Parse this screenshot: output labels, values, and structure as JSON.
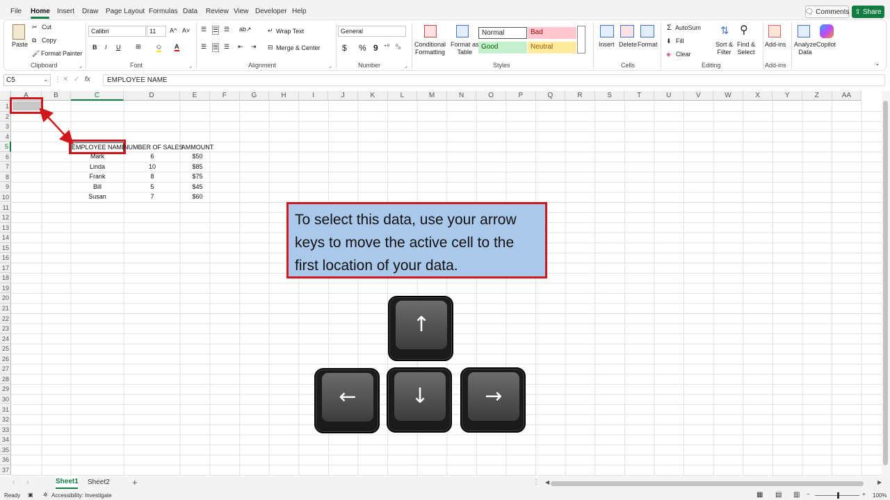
{
  "menu": {
    "tabs": [
      "File",
      "Home",
      "Insert",
      "Draw",
      "Page Layout",
      "Formulas",
      "Data",
      "Review",
      "View",
      "Developer",
      "Help"
    ],
    "comments": "Comments",
    "share": "Share"
  },
  "ribbon": {
    "clipboard": {
      "paste": "Paste",
      "cut": "Cut",
      "copy": "Copy",
      "format_painter": "Format Painter",
      "label": "Clipboard"
    },
    "font": {
      "family": "Calibri",
      "size": "11",
      "bold": "B",
      "italic": "I",
      "underline": "U",
      "label": "Font",
      "grow": "A^",
      "shrink": "A˅",
      "font_color_letter": "A"
    },
    "alignment": {
      "wrap_text": "Wrap Text",
      "merge_center": "Merge & Center",
      "label": "Alignment"
    },
    "number": {
      "format": "General",
      "currency": "$",
      "percent": "%",
      "comma": "9",
      "label": "Number"
    },
    "styles": {
      "conditional_formatting_1": "Conditional",
      "conditional_formatting_2": "Formatting",
      "format_as_table_1": "Format as",
      "format_as_table_2": "Table",
      "normal": "Normal",
      "bad": "Bad",
      "good": "Good",
      "neutral": "Neutral",
      "label": "Styles"
    },
    "cells": {
      "insert": "Insert",
      "delete": "Delete",
      "format": "Format",
      "label": "Cells"
    },
    "editing": {
      "autosum": "AutoSum",
      "fill": "Fill",
      "clear": "Clear",
      "sort_filter_1": "Sort &",
      "sort_filter_2": "Filter",
      "find_select_1": "Find &",
      "find_select_2": "Select",
      "label": "Editing"
    },
    "addins": {
      "addins": "Add-ins",
      "label": "Add-ins"
    },
    "analyze": {
      "analyze_1": "Analyze",
      "analyze_2": "Data",
      "copilot": "Copilot"
    }
  },
  "formula_bar": {
    "name_box": "C5",
    "fx": "fx",
    "content": "EMPLOYEE NAME"
  },
  "columns": [
    "A",
    "B",
    "C",
    "D",
    "E",
    "F",
    "G",
    "H",
    "I",
    "J",
    "K",
    "L",
    "M",
    "N",
    "O",
    "P",
    "Q",
    "R",
    "S",
    "T",
    "U",
    "V",
    "W",
    "X",
    "Y",
    "Z",
    "AA"
  ],
  "rows": [
    "1",
    "2",
    "3",
    "4",
    "5",
    "6",
    "7",
    "8",
    "9",
    "10",
    "11",
    "12",
    "13",
    "14",
    "15",
    "16",
    "17",
    "18",
    "19",
    "20",
    "21",
    "22",
    "23",
    "24",
    "25",
    "26",
    "27",
    "28",
    "29",
    "30",
    "31",
    "32",
    "33",
    "34",
    "35",
    "36",
    "37"
  ],
  "table": {
    "headers": [
      "EMPLOYEE NAME",
      "NUMBER OF SALES",
      "AMMOUNT"
    ],
    "rows": [
      [
        "Mark",
        "6",
        "$50"
      ],
      [
        "Linda",
        "10",
        "$85"
      ],
      [
        "Frank",
        "8",
        "$75"
      ],
      [
        "Bill",
        "5",
        "$45"
      ],
      [
        "Susan",
        "7",
        "$60"
      ]
    ]
  },
  "callout": {
    "text": "To select this data, use your arrow keys to move the active cell to the first location of your data."
  },
  "keys": {
    "up": "↑",
    "left": "←",
    "down": "↓",
    "right": "→"
  },
  "sheets": {
    "tab1": "Sheet1",
    "tab2": "Sheet2",
    "add": "+"
  },
  "status": {
    "ready": "Ready",
    "accessibility": "Accessibility: Investigate",
    "zoom": "100%"
  },
  "colors": {
    "accent": "#107c41",
    "highlight": "#d0171d",
    "callout_bg": "#a9c8ea"
  }
}
